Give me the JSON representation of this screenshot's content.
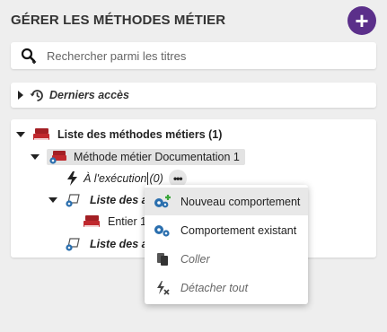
{
  "header": {
    "title": "GÉRER LES MÉTHODES MÉTIER",
    "add_icon": "plus-icon",
    "accent": "#5b2f8a"
  },
  "search": {
    "placeholder": "Rechercher parmi les titres",
    "icon": "search-icon"
  },
  "recent": {
    "label": "Derniers accès",
    "icon": "history-icon"
  },
  "tree": {
    "root": {
      "label": "Liste des méthodes métiers (1)"
    },
    "method": {
      "label": "Méthode métier Documentation 1"
    },
    "execution": {
      "label": "À l'exécution",
      "count": "(0)",
      "more": "•••"
    },
    "list_a": {
      "label": "Liste des ar"
    },
    "entier": {
      "label": "Entier 1"
    },
    "list_b": {
      "label": "Liste des ar"
    }
  },
  "menu": {
    "items": [
      {
        "label": "Nouveau comportement",
        "icon": "gear-add-icon",
        "enabled": true,
        "selected": true
      },
      {
        "label": "Comportement existant",
        "icon": "gears-icon",
        "enabled": true,
        "selected": false
      },
      {
        "label": "Coller",
        "icon": "paste-icon",
        "enabled": false,
        "selected": false
      },
      {
        "label": "Détacher tout",
        "icon": "detach-icon",
        "enabled": false,
        "selected": false
      }
    ]
  },
  "colors": {
    "book_red": "#c0282d",
    "gear_blue": "#2b6fae",
    "add_green": "#3aa63a"
  }
}
